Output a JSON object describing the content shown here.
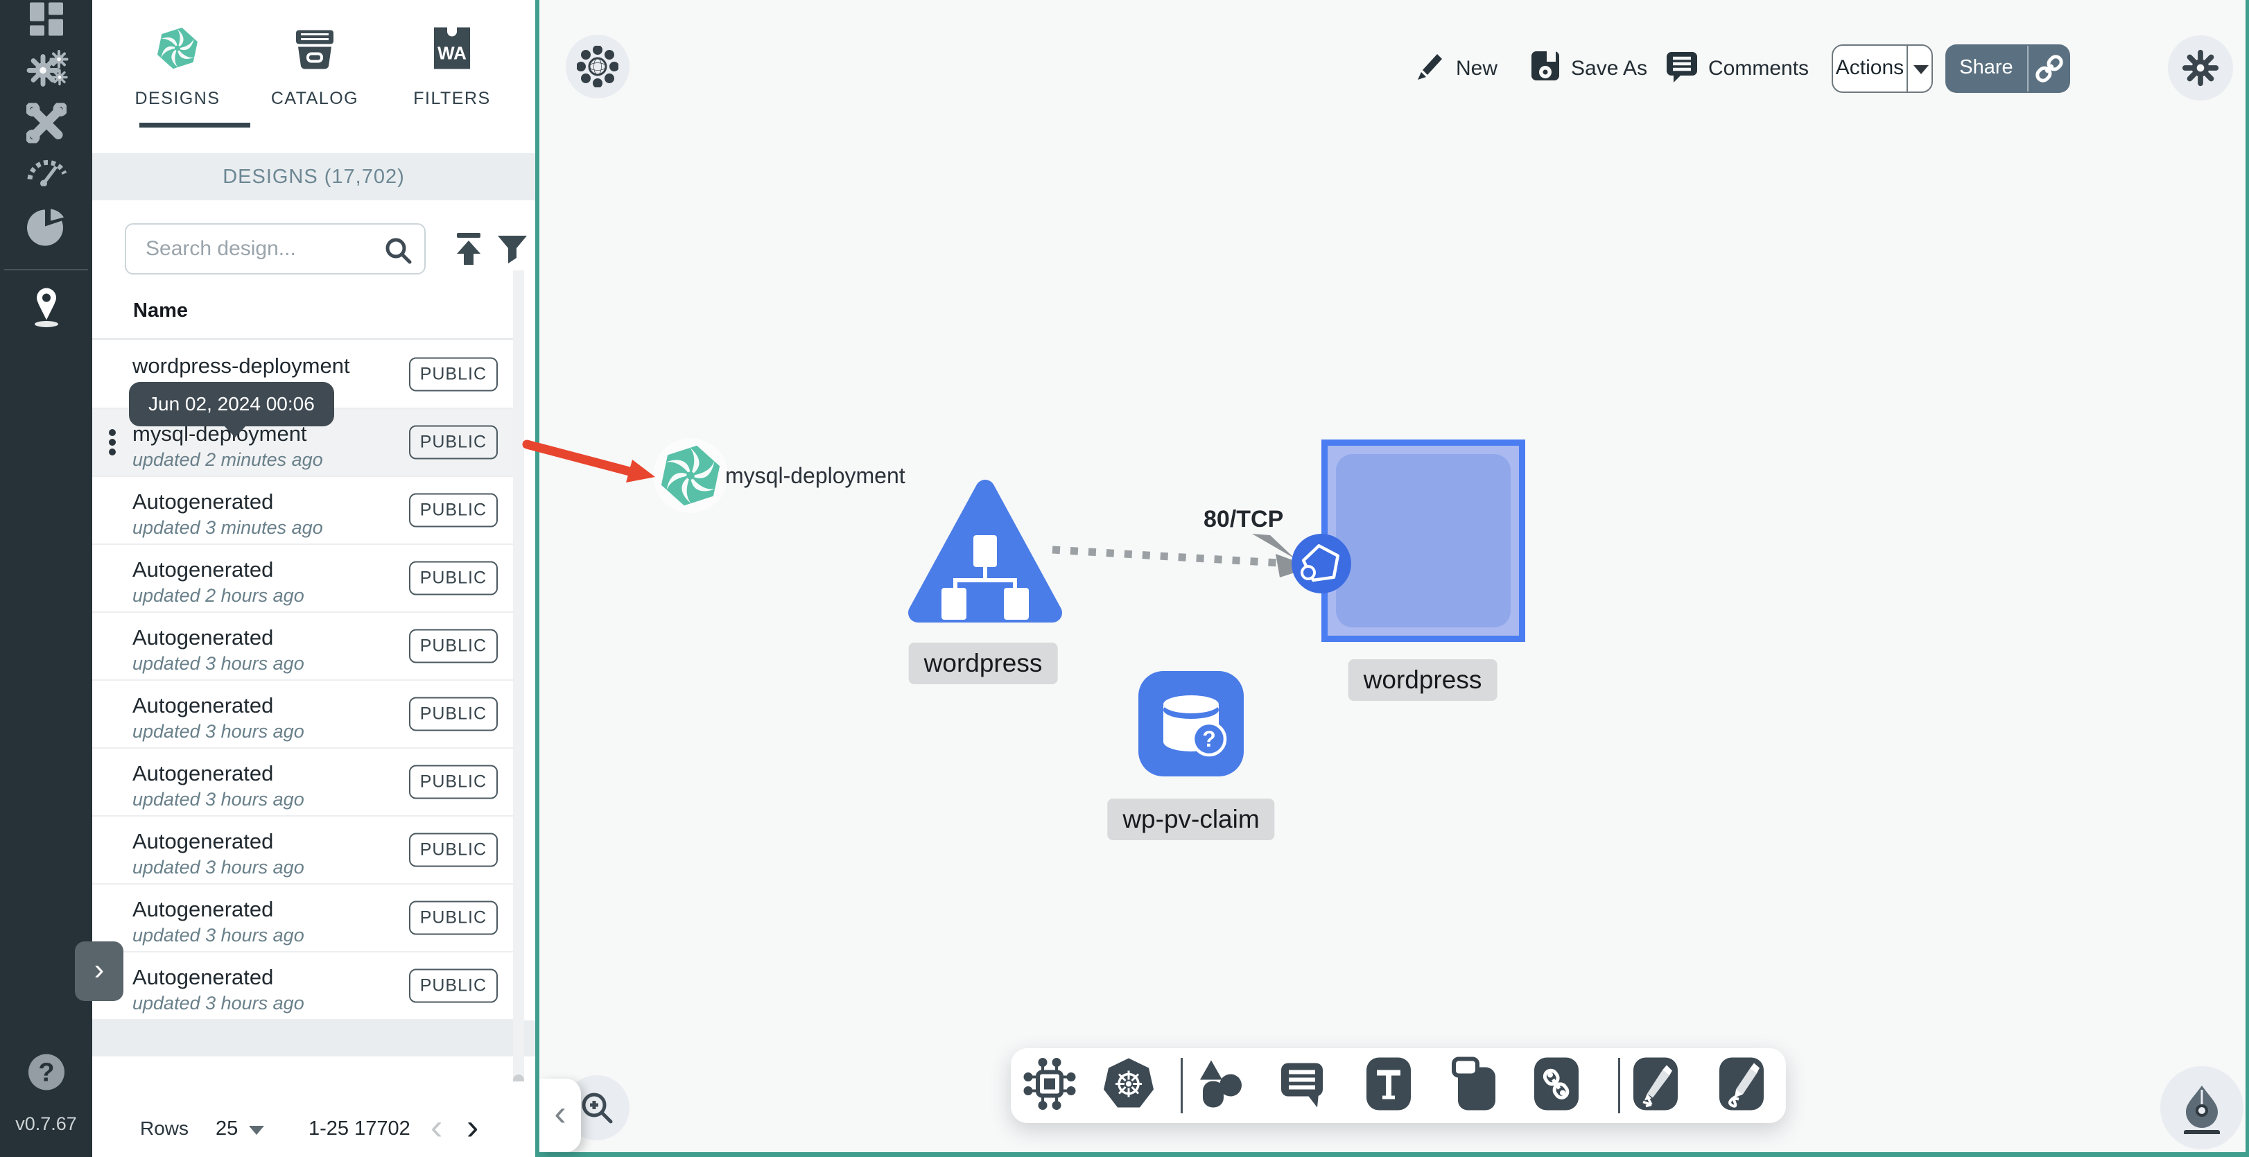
{
  "app": {
    "version": "v0.7.67"
  },
  "glyphs": {
    "wa": "WA",
    "question": "?",
    "chev_right": "›",
    "chev_left": "‹"
  },
  "rail": {
    "items": [
      "dashboard",
      "lifecycle",
      "configuration",
      "performance",
      "extensions",
      "kanvas",
      "help"
    ]
  },
  "panel": {
    "tabs": [
      {
        "label": "DESIGNS"
      },
      {
        "label": "CATALOG"
      },
      {
        "label": "FILTERS"
      }
    ],
    "header": "DESIGNS (17,702)",
    "search": {
      "placeholder": "Search design..."
    },
    "columns": {
      "name": "Name"
    },
    "tooltip": {
      "text": "Jun 02, 2024 00:06"
    },
    "rows": [
      {
        "name": "wordpress-deployment",
        "subtitle": "",
        "badge": "PUBLIC"
      },
      {
        "name": "mysql-deployment",
        "subtitle": "updated 2 minutes ago",
        "badge": "PUBLIC",
        "selected": true
      },
      {
        "name": "Autogenerated",
        "subtitle": "updated 3 minutes ago",
        "badge": "PUBLIC"
      },
      {
        "name": "Autogenerated",
        "subtitle": "updated 2 hours ago",
        "badge": "PUBLIC"
      },
      {
        "name": "Autogenerated",
        "subtitle": "updated 3 hours ago",
        "badge": "PUBLIC"
      },
      {
        "name": "Autogenerated",
        "subtitle": "updated 3 hours ago",
        "badge": "PUBLIC"
      },
      {
        "name": "Autogenerated",
        "subtitle": "updated 3 hours ago",
        "badge": "PUBLIC"
      },
      {
        "name": "Autogenerated",
        "subtitle": "updated 3 hours ago",
        "badge": "PUBLIC"
      },
      {
        "name": "Autogenerated",
        "subtitle": "updated 3 hours ago",
        "badge": "PUBLIC"
      },
      {
        "name": "Autogenerated",
        "subtitle": "updated 3 hours ago",
        "badge": "PUBLIC"
      }
    ],
    "pagination": {
      "rows_label": "Rows",
      "per_page": "25",
      "range": "1-25 17702"
    }
  },
  "topbar": {
    "new": "New",
    "save_as": "Save As",
    "comments": "Comments",
    "actions": "Actions",
    "share": "Share"
  },
  "canvas": {
    "nodes": {
      "mysql": {
        "label": "mysql-deployment"
      },
      "deployment": {
        "label": "wordpress"
      },
      "service": {
        "label": "wordpress"
      },
      "pvc": {
        "label": "wp-pv-claim"
      }
    },
    "edge": {
      "label": "80/TCP"
    }
  },
  "bottom_toolbar": {
    "tools": [
      "component",
      "kubernetes",
      "shapes",
      "comment",
      "text",
      "note",
      "link",
      "pen",
      "doodle"
    ]
  },
  "colors": {
    "accent_teal": "#3f9e8e",
    "node_blue": "#4a7ce8",
    "selection_blue": "#4a7cf2",
    "annotation_red": "#e8452e",
    "sidebar_bg": "#263238",
    "share_button": "#5b7181"
  }
}
